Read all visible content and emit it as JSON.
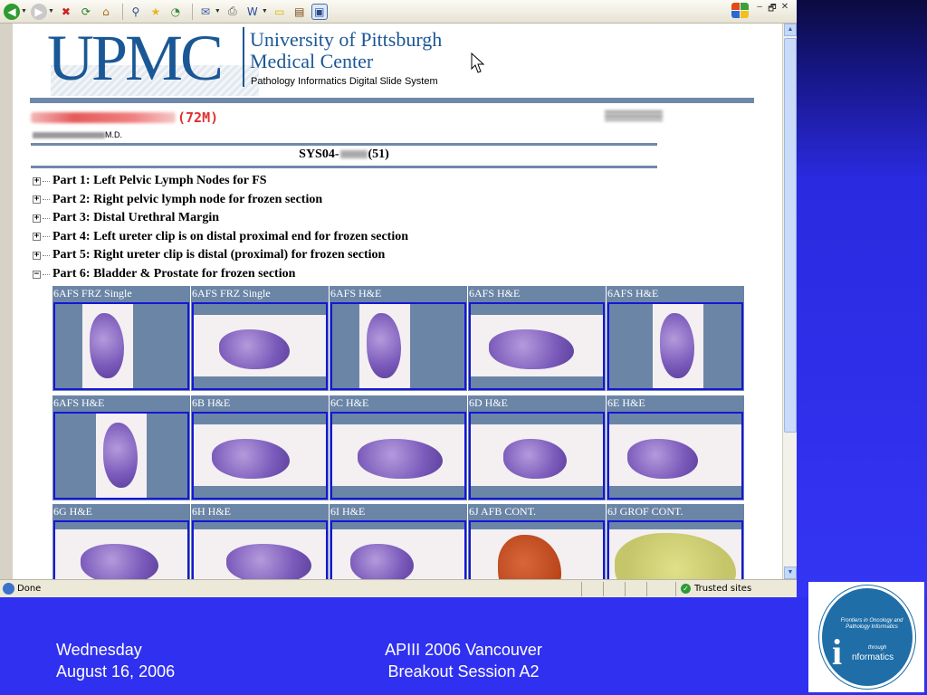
{
  "browser": {
    "status_text": "Done",
    "zone_label": "Trusted sites",
    "window_controls": [
      "‒",
      "🗗",
      "✕"
    ]
  },
  "page": {
    "logo": {
      "mark": "UPMC",
      "org_name": "University of Pittsburgh Medical Center",
      "system_name": "Pathology Informatics Digital Slide System"
    },
    "patient": {
      "age": "(72M)",
      "doctor_suffix": "M.D."
    },
    "case": {
      "prefix": "SYS04-",
      "count": "(51)"
    },
    "parts": [
      {
        "expander": "+",
        "label": "Part 1: Left Pelvic Lymph Nodes for FS"
      },
      {
        "expander": "+",
        "label": "Part 2: Right pelvic lymph node for frozen section"
      },
      {
        "expander": "+",
        "label": "Part 3: Distal Urethral Margin"
      },
      {
        "expander": "+",
        "label": "Part 4: Left ureter clip is on distal proximal end for frozen section"
      },
      {
        "expander": "+",
        "label": "Part 5: Right ureter clip is distal (proximal) for frozen section"
      },
      {
        "expander": "−",
        "label": "Part 6: Bladder & Prostate for frozen section"
      }
    ],
    "slides": [
      {
        "label": "6AFS FRZ Single",
        "stain": "purple"
      },
      {
        "label": "6AFS FRZ Single",
        "stain": "purple"
      },
      {
        "label": "6AFS H&E",
        "stain": "purple"
      },
      {
        "label": "6AFS H&E",
        "stain": "purple"
      },
      {
        "label": "6AFS H&E",
        "stain": "purple"
      },
      {
        "label": "6AFS H&E",
        "stain": "purple"
      },
      {
        "label": "6B H&E",
        "stain": "purple"
      },
      {
        "label": "6C H&E",
        "stain": "purple"
      },
      {
        "label": "6D H&E",
        "stain": "purple"
      },
      {
        "label": "6E H&E",
        "stain": "purple"
      },
      {
        "label": "6G H&E",
        "stain": "purple"
      },
      {
        "label": "6H H&E",
        "stain": "purple"
      },
      {
        "label": "6I H&E",
        "stain": "purple"
      },
      {
        "label": "6J AFB CONT.",
        "stain": "brown"
      },
      {
        "label": "6J GROF CONT.",
        "stain": "yellow"
      }
    ]
  },
  "footer": {
    "day": "Wednesday",
    "date": "August 16, 2006",
    "conference": "APIII 2006 Vancouver",
    "session": "Breakout Session A2"
  },
  "badge": {
    "tagline": "Frontiers in Oncology and Pathology Informatics",
    "through": "through",
    "word": "nformatics"
  },
  "colors": {
    "slide_background": "#3030f0",
    "upmc_blue": "#1a5796",
    "slide_border": "#1616d8",
    "label_bar": "#6b85a6",
    "age_red": "#e03030"
  }
}
